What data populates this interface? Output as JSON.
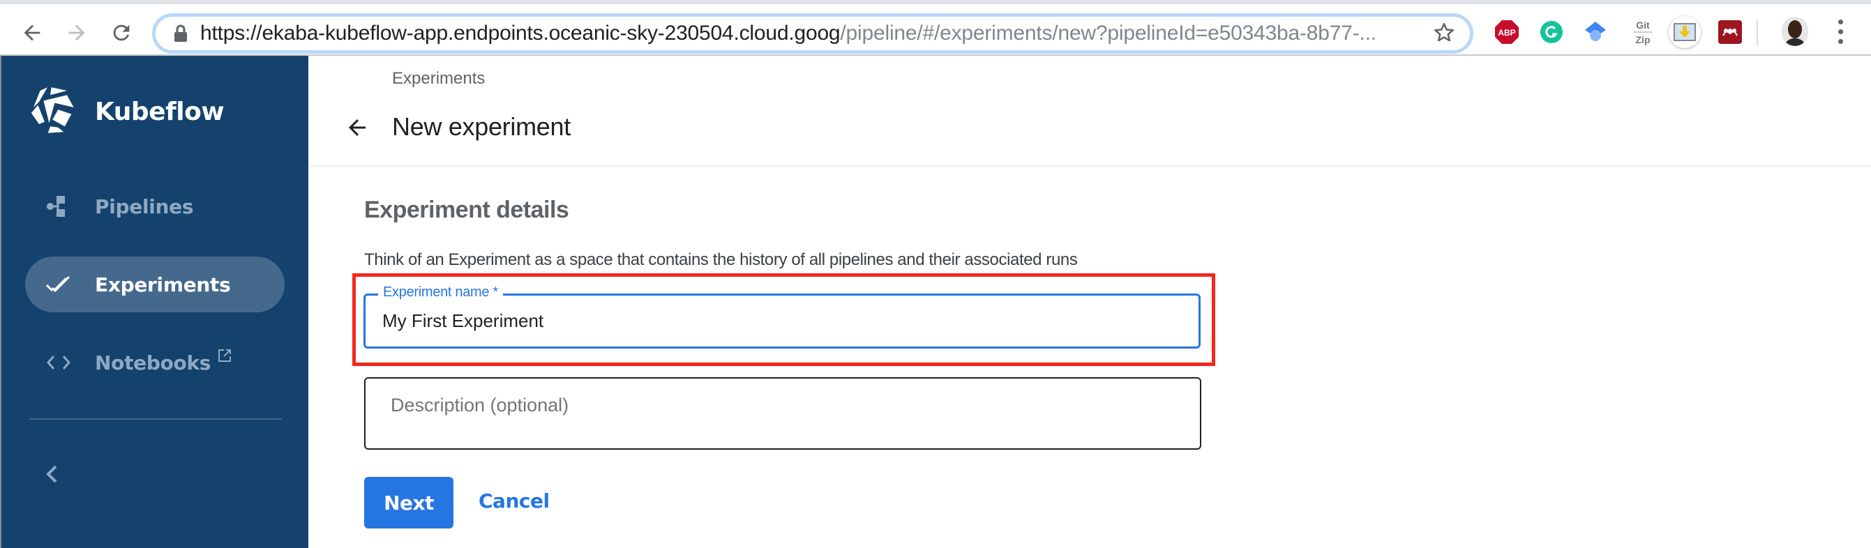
{
  "browser": {
    "url_host": "https://ekaba-kubeflow-app.endpoints.oceanic-sky-230504.cloud.goog",
    "url_path": "/pipeline/#/experiments/new?pipelineId=e50343ba-8b77-...",
    "extensions": [
      {
        "name": "adblock-plus",
        "label": "ABP",
        "color": "#c70d2c"
      },
      {
        "name": "grammarly",
        "label": "G",
        "color": "#15c39a"
      },
      {
        "name": "google-scholar",
        "label": "",
        "color": "#4285f4"
      },
      {
        "name": "gitzip",
        "label": "Git Zip",
        "color": "#777777"
      },
      {
        "name": "image-downloader",
        "label": "",
        "color": "#f4c20d"
      },
      {
        "name": "mendeley",
        "label": "",
        "color": "#9d1620"
      }
    ]
  },
  "sidebar": {
    "brand": "Kubeflow",
    "items": [
      {
        "label": "Pipelines",
        "icon": "pipeline-icon",
        "active": false
      },
      {
        "label": "Experiments",
        "icon": "double-check-icon",
        "active": true
      },
      {
        "label": "Notebooks",
        "icon": "code-icon",
        "active": false,
        "external": true
      }
    ]
  },
  "header": {
    "breadcrumb": "Experiments",
    "title": "New experiment"
  },
  "form": {
    "section_title": "Experiment details",
    "section_description": "Think of an Experiment as a space that contains the history of all pipelines and their associated runs",
    "name_label": "Experiment name *",
    "name_value": "My First Experiment",
    "description_placeholder": "Description (optional)",
    "description_value": "",
    "next_label": "Next",
    "cancel_label": "Cancel"
  },
  "colors": {
    "sidebar_bg": "#14426c",
    "accent": "#2676e2",
    "highlight": "#f2281e"
  }
}
